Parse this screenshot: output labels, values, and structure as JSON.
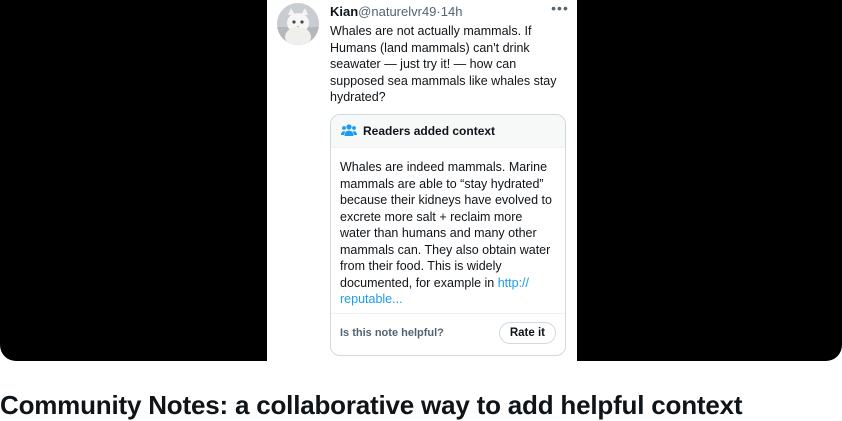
{
  "tweet": {
    "author_name": "Kian",
    "author_handle": "@naturelvr49",
    "separator": "·",
    "timestamp": "14h",
    "more_label": "•••",
    "text": "Whales are not actually mammals. If Humans (land mammals) can't drink seawater — just try it! — how can supposed sea mammals like whales stay hydrated?",
    "avatar_icon": "cat-photo-avatar"
  },
  "community_note": {
    "header_label": "Readers added context",
    "header_icon": "people-icon",
    "header_icon_color": "#1d9bf0",
    "body_text": "Whales are indeed mammals. Marine mammals are able to “stay hydrated” because their kidneys have evolved to excrete more salt + reclaim more water than humans and many other mammals can. They also obtain water from their food. This is widely documented, for example in ",
    "link_text": "http:// reputable...",
    "link_color": "#1d9bf0",
    "helpful_question": "Is this note helpful?",
    "rate_button_label": "Rate it"
  },
  "page": {
    "title": "Community Notes: a collaborative way to add helpful context",
    "hero_background": "#000000"
  }
}
